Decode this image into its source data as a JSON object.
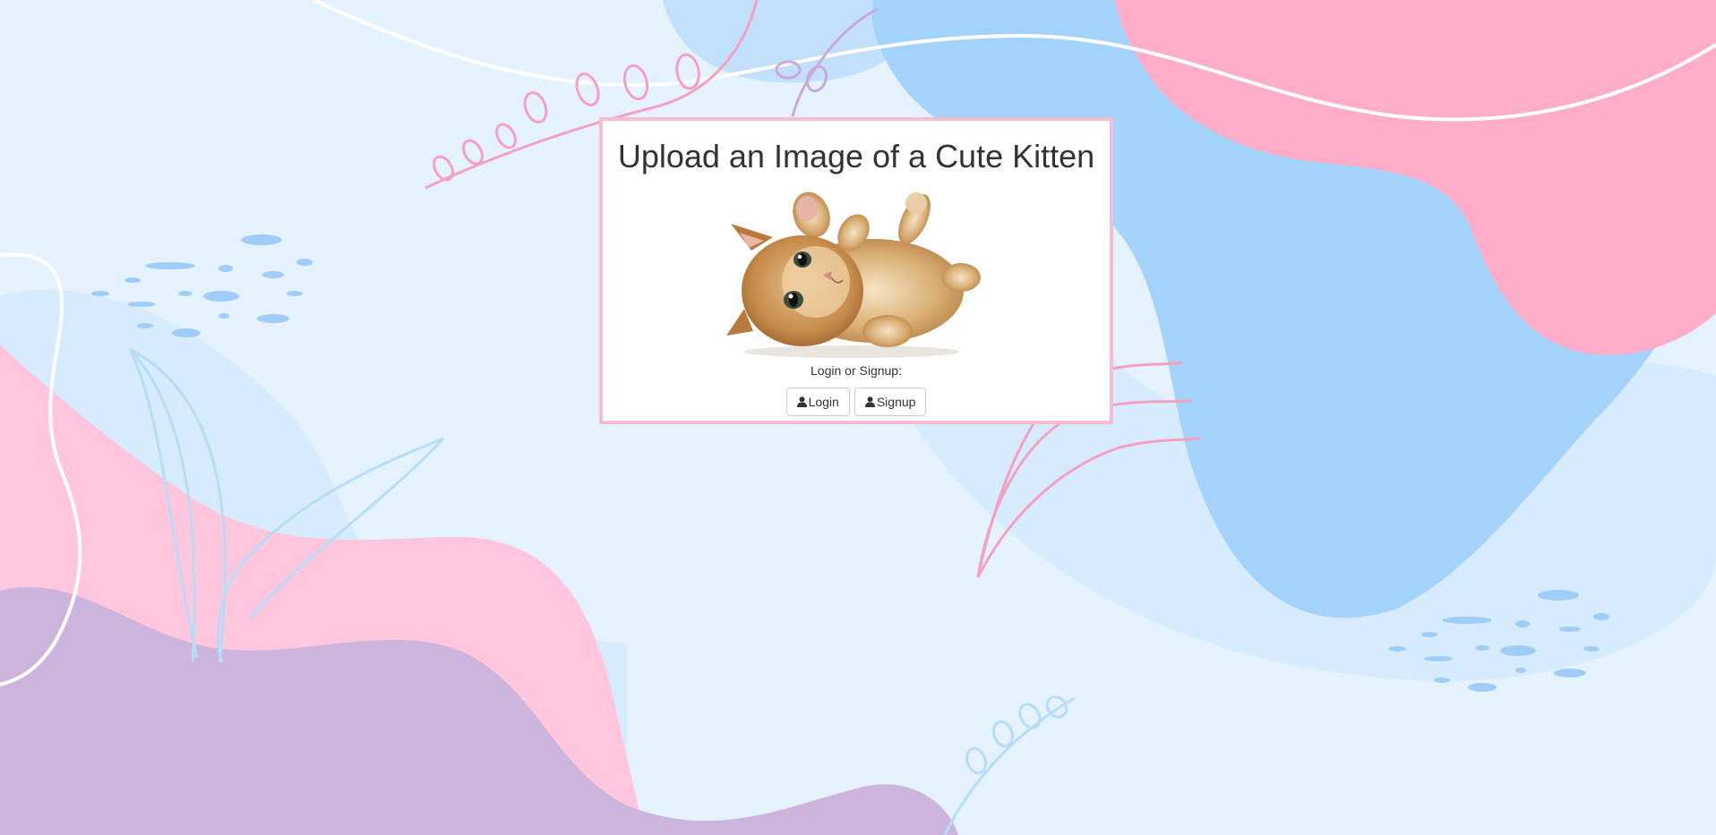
{
  "page": {
    "title": "Upload an Image of a Cute Kitten",
    "prompt": "Login or Signup:"
  },
  "auth": {
    "login_label": "Login",
    "login_icon": "user-icon",
    "signup_label": "Signup",
    "signup_icon": "user-icon"
  },
  "colors": {
    "background": "#e3f2fd",
    "card_border": "#f8bbd0",
    "pink_blob": "#ffc6dd",
    "purple_blob": "#cdb4dc",
    "blue_blob": "#a3d3fb",
    "light_blue_blob": "#d6ebfd"
  }
}
